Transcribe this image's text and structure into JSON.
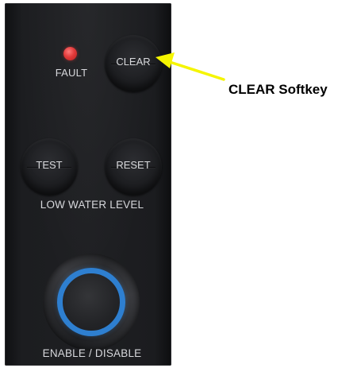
{
  "panel": {
    "fault_label": "FAULT",
    "clear_key_label": "CLEAR",
    "test_key_label": "TEST",
    "reset_key_label": "RESET",
    "low_water_level_label": "LOW WATER LEVEL",
    "enable_disable_label": "ENABLE / DISABLE",
    "fault_led_color": "#e23b3b",
    "enable_ring_color": "#2e7fd0"
  },
  "annotation": {
    "callout_text": "CLEAR Softkey",
    "arrow_color": "#f5f500",
    "arrow_icon": "arrow-icon"
  }
}
